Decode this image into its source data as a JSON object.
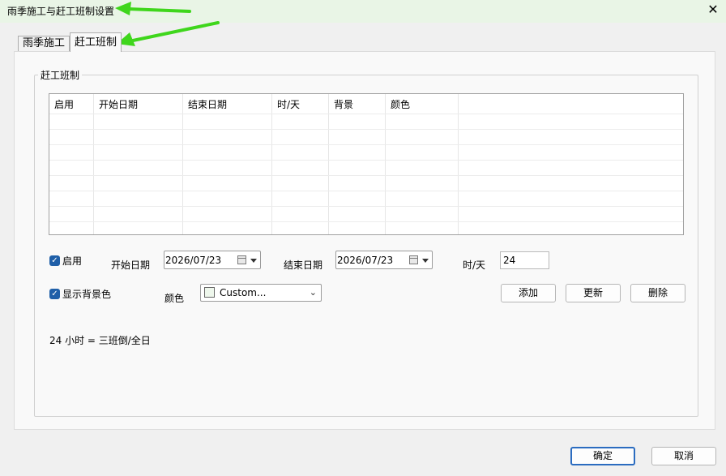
{
  "window": {
    "title": "雨季施工与赶工班制设置",
    "close_label": "✕"
  },
  "tabs": [
    {
      "label": "雨季施工"
    },
    {
      "label": "赶工班制"
    }
  ],
  "group": {
    "title": "赶工班制"
  },
  "table": {
    "columns": [
      "启用",
      "开始日期",
      "结束日期",
      "时/天",
      "背景",
      "颜色"
    ],
    "rows": []
  },
  "form": {
    "enable_label": "启用",
    "enable_checked": true,
    "start_date_label": "开始日期",
    "start_date_value": "2026/07/23",
    "end_date_label": "结束日期",
    "end_date_value": "2026/07/23",
    "hours_label": "时/天",
    "hours_value": "24",
    "show_bg_label": "显示背景色",
    "show_bg_checked": true,
    "color_label": "颜色",
    "color_value": "Custom...",
    "color_swatch": "#eef7ec",
    "add_label": "添加",
    "update_label": "更新",
    "delete_label": "删除",
    "note_text": "24 小时 = 三班倒/全日"
  },
  "footer": {
    "ok_label": "确定",
    "cancel_label": "取消"
  },
  "colors": {
    "accent": "#2b6cc0",
    "checkbox": "#1f5fa8",
    "annotation_arrow": "#3fd61c",
    "titlebar_bg": "#e9f5e6"
  }
}
